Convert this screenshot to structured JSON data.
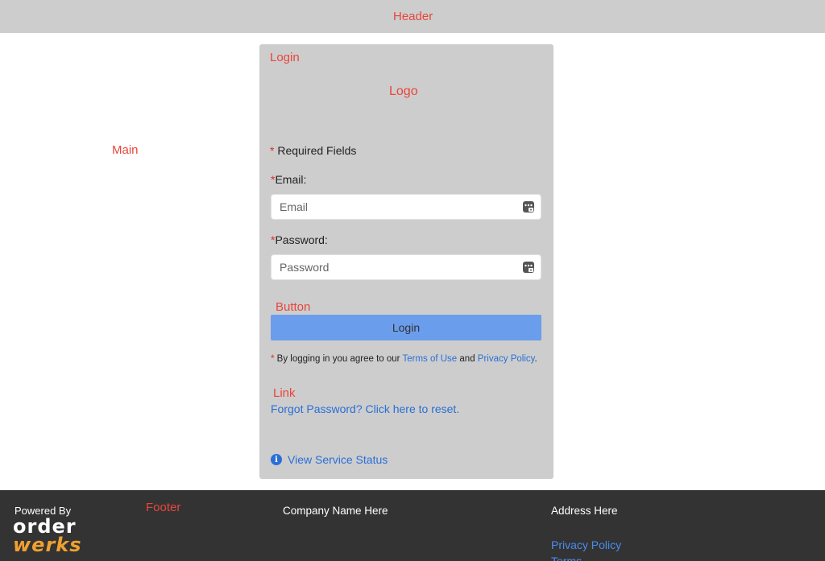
{
  "header": {
    "label": "Header"
  },
  "main": {
    "label": "Main"
  },
  "login": {
    "card_label": "Login",
    "logo_label": "Logo",
    "required_star": "*",
    "required_text": " Required Fields",
    "email": {
      "star": "*",
      "label": "Email:",
      "placeholder": "Email",
      "value": ""
    },
    "password": {
      "star": "*",
      "label": "Password:",
      "placeholder": "Password",
      "value": ""
    },
    "button_label": "Button",
    "login_button": "Login",
    "terms": {
      "star": "*",
      "prefix": " By logging in you agree to our ",
      "terms_link": "Terms of Use",
      "middle": " and ",
      "privacy_link": "Privacy Policy",
      "suffix": "."
    },
    "link_label": "Link",
    "forgot_link": "Forgot Password? Click here to reset.",
    "service_status": "View Service Status",
    "info_icon": "info-icon",
    "key_icon": "password-manager-key-icon"
  },
  "footer": {
    "powered_by": "Powered By",
    "brand_line1": "order",
    "brand_line2": "werks",
    "label": "Footer",
    "company": "Company Name Here",
    "address": "Address Here",
    "privacy_link": "Privacy Policy",
    "terms_link": "Terms"
  },
  "colors": {
    "header_bg": "#cdcdcd",
    "card_bg": "#cdcdcd",
    "button_bg": "#6b9ded",
    "link": "#2a6fd6",
    "label_red": "#e8463a",
    "footer_bg": "#333333",
    "brand_orange": "#f0a030"
  }
}
